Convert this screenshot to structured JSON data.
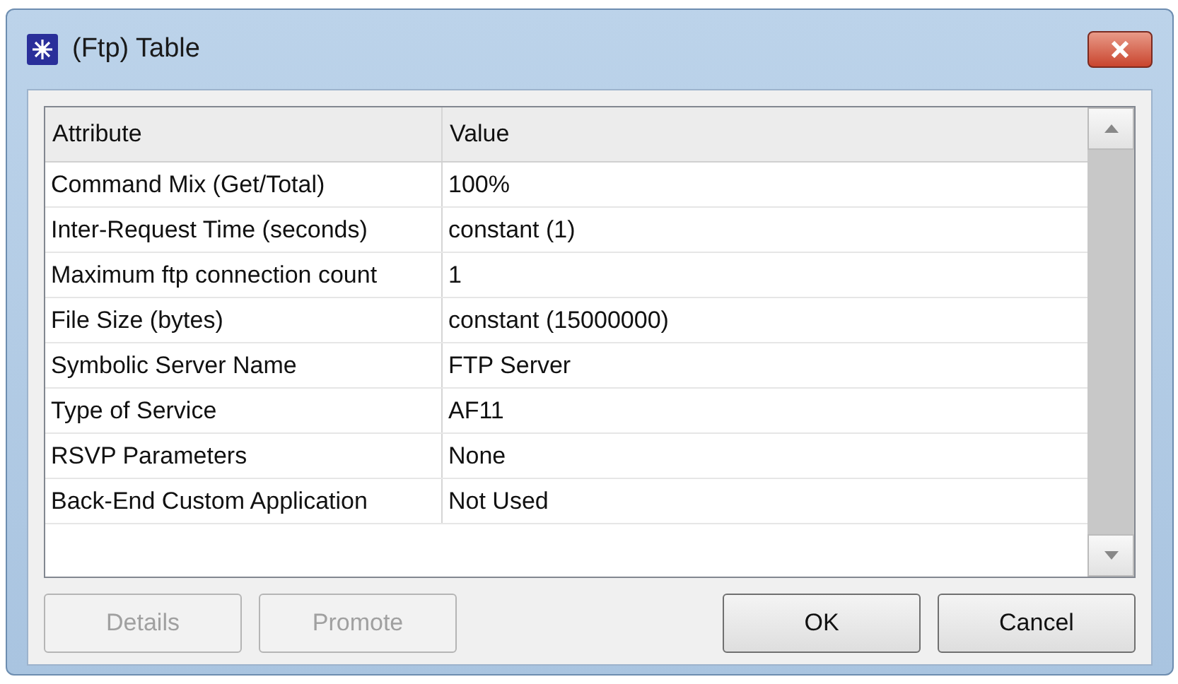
{
  "window": {
    "title": "(Ftp) Table"
  },
  "table": {
    "columns": [
      "Attribute",
      "Value"
    ],
    "rows": [
      {
        "attribute": "Command Mix (Get/Total)",
        "value": "100%"
      },
      {
        "attribute": "Inter-Request Time (seconds)",
        "value": "constant (1)"
      },
      {
        "attribute": "Maximum ftp connection count",
        "value": "1"
      },
      {
        "attribute": "File Size (bytes)",
        "value": "constant (15000000)"
      },
      {
        "attribute": "Symbolic Server Name",
        "value": "FTP Server"
      },
      {
        "attribute": "Type of Service",
        "value": "AF11"
      },
      {
        "attribute": "RSVP Parameters",
        "value": "None"
      },
      {
        "attribute": "Back-End Custom Application",
        "value": "Not Used"
      }
    ]
  },
  "buttons": [
    {
      "label": "Details",
      "disabled": true
    },
    {
      "label": "Promote",
      "disabled": true
    },
    {
      "label": "OK",
      "disabled": false
    },
    {
      "label": "Cancel",
      "disabled": false
    }
  ]
}
